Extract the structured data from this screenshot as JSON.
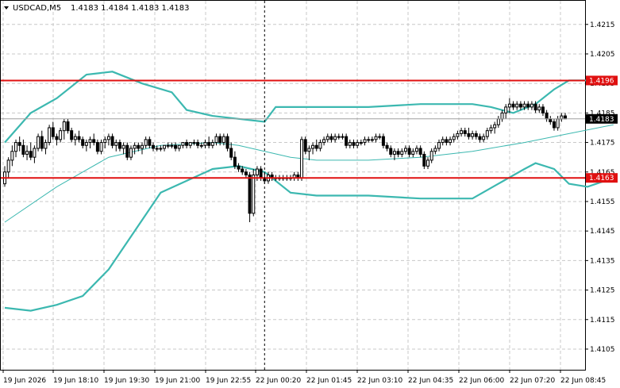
{
  "header": {
    "symbol": "USDCAD,M5",
    "ohlc": "1.4183 1.4184 1.4183 1.4183"
  },
  "colors": {
    "background": "#ffffff",
    "grid": "#c8c8c8",
    "candle": "#000000",
    "band": "#3cb8b0",
    "ma": "#3cb8b0",
    "level": "#e01010",
    "price_label_bg": "#000000"
  },
  "chart_data": {
    "type": "candlestick",
    "x_ticks": [
      "19 Jun 2026",
      "19 Jun 18:10",
      "19 Jun 19:30",
      "19 Jun 21:00",
      "19 Jun 22:55",
      "22 Jun 00:20",
      "22 Jun 01:45",
      "22 Jun 03:10",
      "22 Jun 04:35",
      "22 Jun 06:00",
      "22 Jun 07:20",
      "22 Jun 08:45"
    ],
    "y_ticks": [
      "1.4215",
      "1.4205",
      "1.4195",
      "1.4185",
      "1.4175",
      "1.4165",
      "1.4155",
      "1.4145",
      "1.4135",
      "1.4125",
      "1.4115",
      "1.4105"
    ],
    "ylim": [
      1.4098,
      1.4223
    ],
    "grid": true,
    "current_price": "1.4183",
    "levels": [
      {
        "label": "1.4196",
        "value": 1.4196
      },
      {
        "label": "1.4163",
        "value": 1.4163
      }
    ],
    "candles": [
      [
        1.4161,
        1.4167,
        1.416,
        1.4165
      ],
      [
        1.4165,
        1.417,
        1.4163,
        1.4169
      ],
      [
        1.4169,
        1.4174,
        1.4167,
        1.4172
      ],
      [
        1.4172,
        1.4176,
        1.417,
        1.4175
      ],
      [
        1.4175,
        1.4177,
        1.4172,
        1.4174
      ],
      [
        1.4174,
        1.4176,
        1.417,
        1.4171
      ],
      [
        1.4171,
        1.4174,
        1.4169,
        1.4172
      ],
      [
        1.4172,
        1.4175,
        1.4169,
        1.417
      ],
      [
        1.417,
        1.4174,
        1.4168,
        1.4173
      ],
      [
        1.4173,
        1.4178,
        1.4172,
        1.4177
      ],
      [
        1.4177,
        1.4179,
        1.4172,
        1.4173
      ],
      [
        1.4173,
        1.4176,
        1.4171,
        1.4175
      ],
      [
        1.4175,
        1.4181,
        1.4174,
        1.418
      ],
      [
        1.418,
        1.4182,
        1.4176,
        1.4177
      ],
      [
        1.4177,
        1.4178,
        1.4174,
        1.4176
      ],
      [
        1.4176,
        1.418,
        1.4175,
        1.4179
      ],
      [
        1.4179,
        1.4183,
        1.4176,
        1.4182
      ],
      [
        1.4182,
        1.4183,
        1.4178,
        1.4179
      ],
      [
        1.4179,
        1.418,
        1.4175,
        1.4176
      ],
      [
        1.4176,
        1.4178,
        1.4174,
        1.4177
      ],
      [
        1.4177,
        1.4179,
        1.4175,
        1.4176
      ],
      [
        1.4176,
        1.4177,
        1.4173,
        1.4174
      ],
      [
        1.4174,
        1.4176,
        1.4172,
        1.4175
      ],
      [
        1.4175,
        1.4177,
        1.4173,
        1.4176
      ],
      [
        1.4176,
        1.4178,
        1.4174,
        1.4175
      ],
      [
        1.4175,
        1.4176,
        1.4171,
        1.4172
      ],
      [
        1.4172,
        1.4176,
        1.4171,
        1.4175
      ],
      [
        1.4175,
        1.4177,
        1.4173,
        1.4176
      ],
      [
        1.4176,
        1.4178,
        1.4174,
        1.4177
      ],
      [
        1.4177,
        1.4178,
        1.4173,
        1.4174
      ],
      [
        1.4174,
        1.4176,
        1.4172,
        1.4175
      ],
      [
        1.4175,
        1.4176,
        1.4172,
        1.4173
      ],
      [
        1.4173,
        1.4175,
        1.4171,
        1.4174
      ],
      [
        1.4174,
        1.4175,
        1.4169,
        1.417
      ],
      [
        1.417,
        1.4174,
        1.4169,
        1.4173
      ],
      [
        1.4173,
        1.4175,
        1.4171,
        1.4174
      ],
      [
        1.4174,
        1.4175,
        1.4172,
        1.4173
      ],
      [
        1.4173,
        1.4175,
        1.4171,
        1.4174
      ],
      [
        1.4174,
        1.4177,
        1.4173,
        1.4176
      ],
      [
        1.4176,
        1.4177,
        1.4173,
        1.4174
      ],
      [
        1.4174,
        1.4175,
        1.4172,
        1.4173
      ],
      [
        1.4173,
        1.4174,
        1.4172,
        1.4173
      ],
      [
        1.4173,
        1.4174,
        1.4172,
        1.4173
      ],
      [
        1.4173,
        1.4174,
        1.4172,
        1.4174
      ],
      [
        1.4174,
        1.4175,
        1.4173,
        1.4174
      ],
      [
        1.4174,
        1.4175,
        1.4173,
        1.4174
      ],
      [
        1.4174,
        1.4175,
        1.4172,
        1.4173
      ],
      [
        1.4173,
        1.4174,
        1.4172,
        1.4174
      ],
      [
        1.4174,
        1.4175,
        1.4173,
        1.4175
      ],
      [
        1.4175,
        1.4176,
        1.4173,
        1.4174
      ],
      [
        1.4174,
        1.4175,
        1.4173,
        1.4175
      ],
      [
        1.4175,
        1.4176,
        1.4174,
        1.4175
      ],
      [
        1.4175,
        1.4176,
        1.4173,
        1.4174
      ],
      [
        1.4174,
        1.4175,
        1.4173,
        1.4174
      ],
      [
        1.4174,
        1.4176,
        1.4173,
        1.4175
      ],
      [
        1.4175,
        1.4177,
        1.4173,
        1.4174
      ],
      [
        1.4174,
        1.4176,
        1.4173,
        1.4175
      ],
      [
        1.4175,
        1.4178,
        1.4174,
        1.4177
      ],
      [
        1.4177,
        1.4178,
        1.4174,
        1.4175
      ],
      [
        1.4175,
        1.4178,
        1.4174,
        1.4177
      ],
      [
        1.4177,
        1.4178,
        1.4172,
        1.4173
      ],
      [
        1.4173,
        1.4175,
        1.4169,
        1.417
      ],
      [
        1.417,
        1.4172,
        1.4166,
        1.4167
      ],
      [
        1.4167,
        1.4168,
        1.4165,
        1.4166
      ],
      [
        1.4166,
        1.4167,
        1.4164,
        1.4165
      ],
      [
        1.4165,
        1.4166,
        1.4163,
        1.4164
      ],
      [
        1.4164,
        1.4165,
        1.4148,
        1.4151
      ],
      [
        1.4151,
        1.4166,
        1.415,
        1.4164
      ],
      [
        1.4164,
        1.4167,
        1.4162,
        1.4166
      ],
      [
        1.4166,
        1.4167,
        1.4162,
        1.4163
      ],
      [
        1.4163,
        1.4165,
        1.4161,
        1.4162
      ],
      [
        1.4162,
        1.4165,
        1.4161,
        1.4164
      ],
      [
        1.4164,
        1.4165,
        1.4162,
        1.4163
      ],
      [
        1.4163,
        1.4164,
        1.4162,
        1.4163
      ],
      [
        1.4163,
        1.4164,
        1.4162,
        1.4163
      ],
      [
        1.4163,
        1.4164,
        1.4162,
        1.4163
      ],
      [
        1.4163,
        1.4164,
        1.4162,
        1.4163
      ],
      [
        1.4163,
        1.4164,
        1.4162,
        1.4163
      ],
      [
        1.4163,
        1.4165,
        1.4162,
        1.4164
      ],
      [
        1.4164,
        1.4165,
        1.4162,
        1.4163
      ],
      [
        1.4163,
        1.4177,
        1.4162,
        1.4176
      ],
      [
        1.4176,
        1.4177,
        1.4171,
        1.4172
      ],
      [
        1.4172,
        1.4174,
        1.4169,
        1.4173
      ],
      [
        1.4173,
        1.4175,
        1.4171,
        1.4174
      ],
      [
        1.4174,
        1.4176,
        1.4172,
        1.4173
      ],
      [
        1.4173,
        1.4176,
        1.4172,
        1.4175
      ],
      [
        1.4175,
        1.4177,
        1.4174,
        1.4176
      ],
      [
        1.4176,
        1.4178,
        1.4175,
        1.4177
      ],
      [
        1.4177,
        1.4178,
        1.4175,
        1.4176
      ],
      [
        1.4176,
        1.4178,
        1.4175,
        1.4177
      ],
      [
        1.4177,
        1.4178,
        1.4176,
        1.4177
      ],
      [
        1.4177,
        1.4178,
        1.4176,
        1.4177
      ],
      [
        1.4177,
        1.4178,
        1.4173,
        1.4174
      ],
      [
        1.4174,
        1.4176,
        1.4173,
        1.4175
      ],
      [
        1.4175,
        1.4176,
        1.4173,
        1.4174
      ],
      [
        1.4174,
        1.4176,
        1.4173,
        1.4175
      ],
      [
        1.4175,
        1.4176,
        1.4174,
        1.4175
      ],
      [
        1.4175,
        1.4177,
        1.4174,
        1.4176
      ],
      [
        1.4176,
        1.4177,
        1.4175,
        1.4176
      ],
      [
        1.4176,
        1.4177,
        1.4175,
        1.4176
      ],
      [
        1.4176,
        1.4178,
        1.4175,
        1.4177
      ],
      [
        1.4177,
        1.4178,
        1.4176,
        1.4177
      ],
      [
        1.4177,
        1.4178,
        1.4173,
        1.4174
      ],
      [
        1.4174,
        1.4175,
        1.4172,
        1.4173
      ],
      [
        1.4173,
        1.4174,
        1.417,
        1.4171
      ],
      [
        1.4171,
        1.4173,
        1.4169,
        1.4172
      ],
      [
        1.4172,
        1.4173,
        1.417,
        1.4171
      ],
      [
        1.4171,
        1.4173,
        1.417,
        1.4172
      ],
      [
        1.4172,
        1.4174,
        1.4171,
        1.4173
      ],
      [
        1.4173,
        1.4174,
        1.417,
        1.4171
      ],
      [
        1.4171,
        1.4173,
        1.417,
        1.4172
      ],
      [
        1.4172,
        1.4174,
        1.4171,
        1.4173
      ],
      [
        1.4173,
        1.4174,
        1.417,
        1.4171
      ],
      [
        1.4171,
        1.4172,
        1.4166,
        1.4167
      ],
      [
        1.4167,
        1.417,
        1.4166,
        1.4169
      ],
      [
        1.4169,
        1.4173,
        1.4168,
        1.4172
      ],
      [
        1.4172,
        1.4174,
        1.4171,
        1.4173
      ],
      [
        1.4173,
        1.4176,
        1.4172,
        1.4175
      ],
      [
        1.4175,
        1.4177,
        1.4174,
        1.4176
      ],
      [
        1.4176,
        1.4177,
        1.4174,
        1.4175
      ],
      [
        1.4175,
        1.4177,
        1.4174,
        1.4176
      ],
      [
        1.4176,
        1.4178,
        1.4175,
        1.4177
      ],
      [
        1.4177,
        1.4179,
        1.4176,
        1.4178
      ],
      [
        1.4178,
        1.418,
        1.4177,
        1.4179
      ],
      [
        1.4179,
        1.418,
        1.4177,
        1.4178
      ],
      [
        1.4178,
        1.418,
        1.4176,
        1.4177
      ],
      [
        1.4177,
        1.4179,
        1.4176,
        1.4178
      ],
      [
        1.4178,
        1.4179,
        1.4176,
        1.4177
      ],
      [
        1.4177,
        1.4178,
        1.4175,
        1.4176
      ],
      [
        1.4176,
        1.4178,
        1.4175,
        1.4177
      ],
      [
        1.4177,
        1.418,
        1.4176,
        1.4179
      ],
      [
        1.4179,
        1.4181,
        1.4178,
        1.418
      ],
      [
        1.418,
        1.4182,
        1.4178,
        1.4181
      ],
      [
        1.4181,
        1.4184,
        1.418,
        1.4183
      ],
      [
        1.4183,
        1.4186,
        1.4182,
        1.4185
      ],
      [
        1.4185,
        1.4188,
        1.4183,
        1.4187
      ],
      [
        1.4187,
        1.419,
        1.4185,
        1.4188
      ],
      [
        1.4188,
        1.4189,
        1.4186,
        1.4187
      ],
      [
        1.4187,
        1.4189,
        1.4186,
        1.4188
      ],
      [
        1.4188,
        1.4189,
        1.4186,
        1.4187
      ],
      [
        1.4187,
        1.4189,
        1.4186,
        1.4188
      ],
      [
        1.4188,
        1.4189,
        1.4186,
        1.4187
      ],
      [
        1.4187,
        1.4189,
        1.4186,
        1.4188
      ],
      [
        1.4188,
        1.4189,
        1.4185,
        1.4186
      ],
      [
        1.4186,
        1.4188,
        1.4185,
        1.4187
      ],
      [
        1.4187,
        1.4188,
        1.4184,
        1.4185
      ],
      [
        1.4185,
        1.4186,
        1.4182,
        1.4183
      ],
      [
        1.4183,
        1.4184,
        1.4181,
        1.4182
      ],
      [
        1.4182,
        1.4183,
        1.4179,
        1.418
      ],
      [
        1.418,
        1.4184,
        1.4179,
        1.4183
      ],
      [
        1.4183,
        1.4185,
        1.4182,
        1.4184
      ],
      [
        1.4184,
        1.4185,
        1.4183,
        1.4183
      ]
    ],
    "bands": {
      "upper": [
        [
          0,
          1.4175
        ],
        [
          7,
          1.4185
        ],
        [
          14,
          1.419
        ],
        [
          22,
          1.4198
        ],
        [
          29,
          1.4199
        ],
        [
          37,
          1.4195
        ],
        [
          45,
          1.4192
        ],
        [
          49,
          1.4186
        ],
        [
          56,
          1.4184
        ],
        [
          63,
          1.4183
        ],
        [
          70,
          1.4182
        ],
        [
          73,
          1.4187
        ],
        [
          84,
          1.4187
        ],
        [
          98,
          1.4187
        ],
        [
          112,
          1.4188
        ],
        [
          126,
          1.4188
        ],
        [
          131,
          1.4187
        ],
        [
          137,
          1.4185
        ],
        [
          143,
          1.4188
        ],
        [
          148,
          1.4193
        ],
        [
          152,
          1.4196
        ],
        [
          157,
          1.4196
        ],
        [
          164,
          1.4196
        ]
      ],
      "middle": [
        [
          0,
          1.4148
        ],
        [
          14,
          1.416
        ],
        [
          28,
          1.417
        ],
        [
          42,
          1.4174
        ],
        [
          56,
          1.4175
        ],
        [
          63,
          1.4174
        ],
        [
          70,
          1.4172
        ],
        [
          77,
          1.417
        ],
        [
          84,
          1.4169
        ],
        [
          98,
          1.4169
        ],
        [
          112,
          1.417
        ],
        [
          126,
          1.4172
        ],
        [
          140,
          1.4175
        ],
        [
          152,
          1.4178
        ],
        [
          164,
          1.4181
        ]
      ],
      "lower": [
        [
          0,
          1.4119
        ],
        [
          7,
          1.4118
        ],
        [
          14,
          1.412
        ],
        [
          21,
          1.4123
        ],
        [
          28,
          1.4132
        ],
        [
          35,
          1.4145
        ],
        [
          42,
          1.4158
        ],
        [
          49,
          1.4162
        ],
        [
          56,
          1.4166
        ],
        [
          63,
          1.4167
        ],
        [
          70,
          1.4165
        ],
        [
          77,
          1.4158
        ],
        [
          84,
          1.4157
        ],
        [
          98,
          1.4157
        ],
        [
          112,
          1.4156
        ],
        [
          126,
          1.4156
        ],
        [
          133,
          1.4161
        ],
        [
          140,
          1.4166
        ],
        [
          143,
          1.4168
        ],
        [
          148,
          1.4166
        ],
        [
          152,
          1.4161
        ],
        [
          157,
          1.416
        ],
        [
          164,
          1.4163
        ]
      ]
    },
    "separator_bar_index": 70
  }
}
